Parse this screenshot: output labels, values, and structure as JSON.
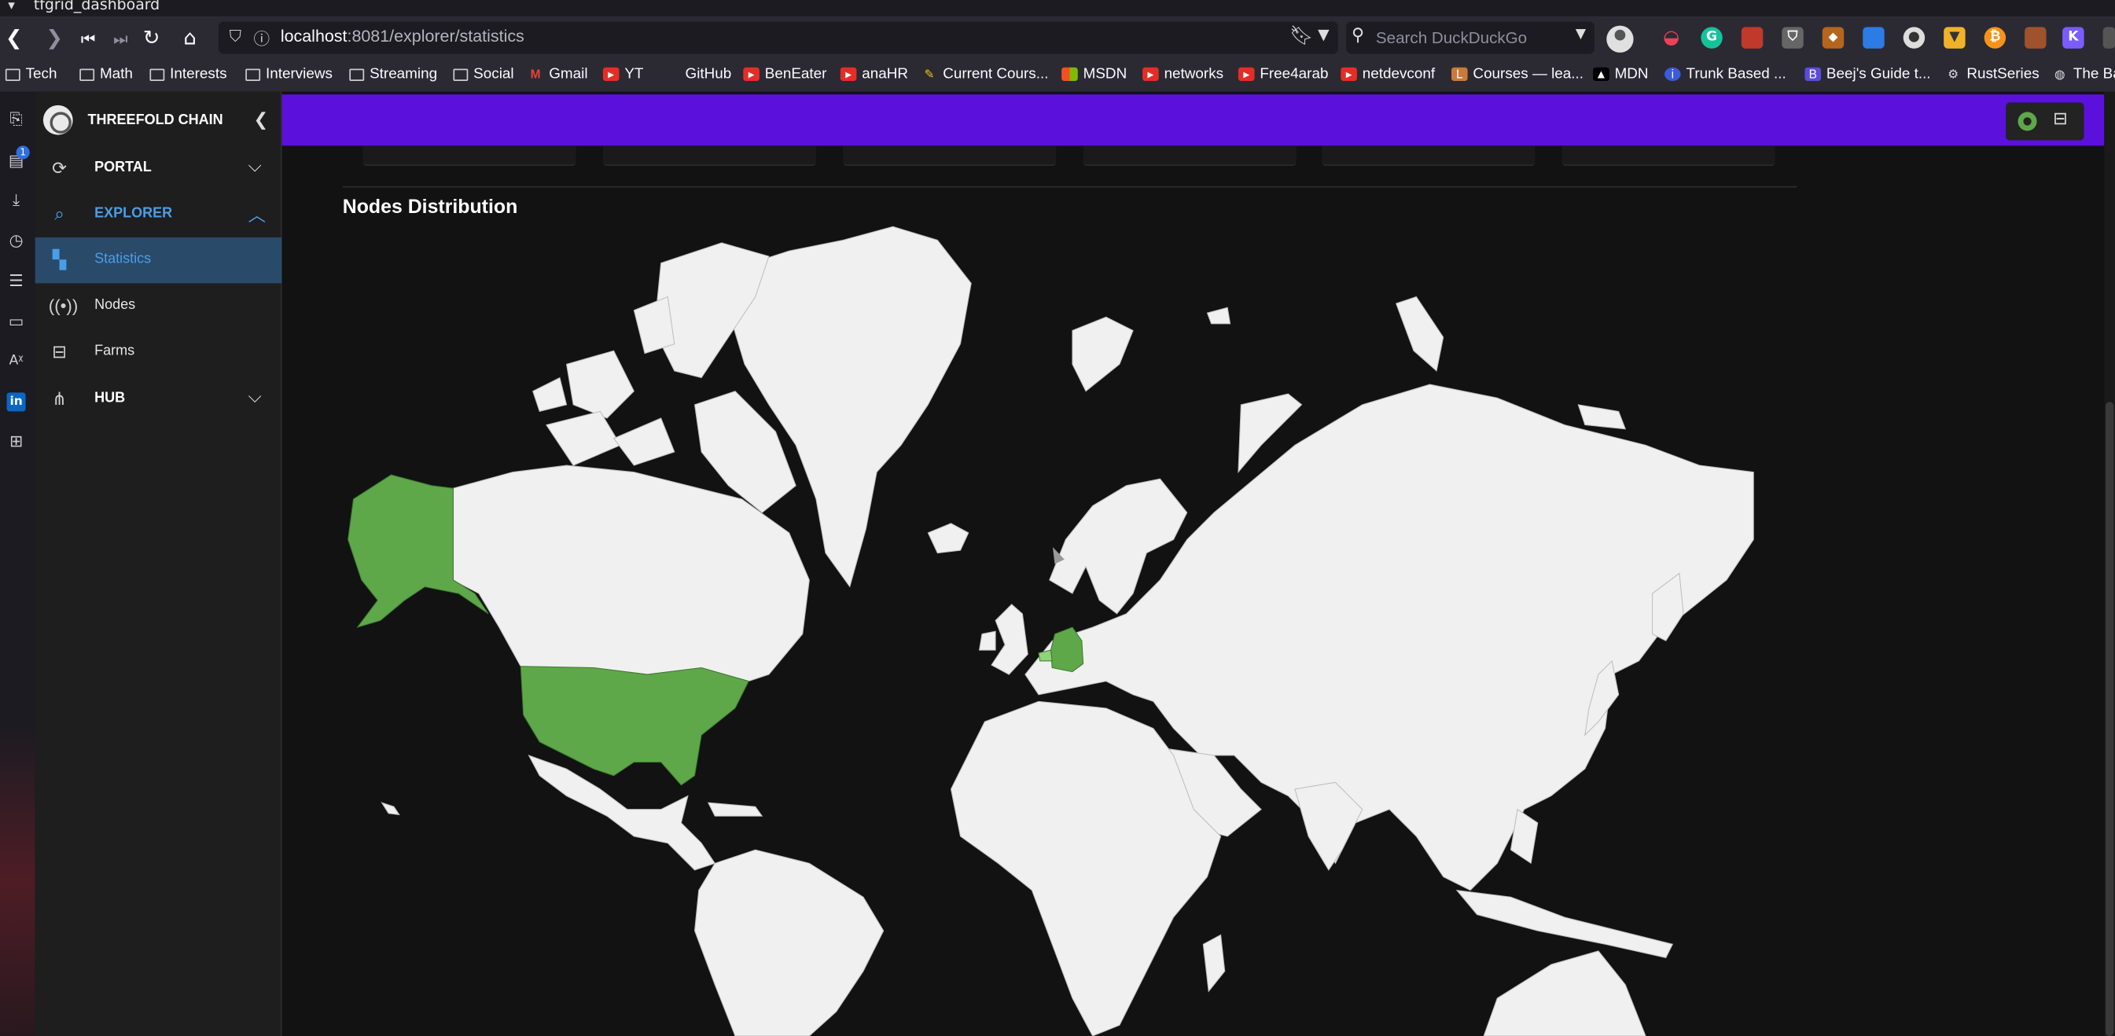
{
  "window": {
    "title": "tfgrid_dashboard"
  },
  "browser": {
    "url_host": "localhost",
    "url_rest": ":8081/explorer/statistics",
    "search_placeholder": "Search DuckDuckGo",
    "sidebar_badge": "1",
    "bookmarks": [
      {
        "label": "Tech",
        "icon": "folder-icon"
      },
      {
        "label": "Math",
        "icon": "folder-icon"
      },
      {
        "label": "Interests",
        "icon": "folder-icon"
      },
      {
        "label": "Interviews",
        "icon": "folder-icon"
      },
      {
        "label": "Streaming",
        "icon": "folder-icon"
      },
      {
        "label": "Social",
        "icon": "folder-icon"
      },
      {
        "label": "Gmail",
        "icon": "gmail-icon"
      },
      {
        "label": "YT",
        "icon": "youtube-icon"
      },
      {
        "label": "GitHub",
        "icon": "github-icon"
      },
      {
        "label": "BenEater",
        "icon": "youtube-icon"
      },
      {
        "label": "anaHR",
        "icon": "youtube-icon"
      },
      {
        "label": "Current Cours...",
        "icon": "course-icon"
      },
      {
        "label": "MSDN",
        "icon": "microsoft-icon"
      },
      {
        "label": "networks",
        "icon": "youtube-icon"
      },
      {
        "label": "Free4arab",
        "icon": "youtube-icon"
      },
      {
        "label": "netdevconf",
        "icon": "youtube-icon"
      },
      {
        "label": "Courses — lea...",
        "icon": "courses-icon"
      },
      {
        "label": "MDN",
        "icon": "mdn-icon"
      },
      {
        "label": "Trunk Based ...",
        "icon": "info-icon"
      },
      {
        "label": "Beej's Guide t...",
        "icon": "beej-icon"
      },
      {
        "label": "RustSeries",
        "icon": "rust-icon"
      },
      {
        "label": "The Ba",
        "icon": "globe-icon"
      }
    ]
  },
  "app": {
    "brand": "THREEFOLD CHAIN",
    "nav": [
      {
        "label": "PORTAL",
        "expanded": false
      },
      {
        "label": "EXPLORER",
        "expanded": true
      },
      {
        "label": "Statistics",
        "active": true
      },
      {
        "label": "Nodes"
      },
      {
        "label": "Farms"
      },
      {
        "label": "HUB",
        "expanded": false
      }
    ],
    "colors": {
      "topbar": "#5c10dc",
      "active_nav": "#4a9ee8",
      "map_land": "#f0f0f0",
      "map_nodes": "#5ea84a",
      "map_light": "#8fd37a"
    },
    "section_title": "Nodes Distribution",
    "highlighted_countries": [
      "United States",
      "Alaska (US)",
      "Germany",
      "Belgium"
    ]
  }
}
